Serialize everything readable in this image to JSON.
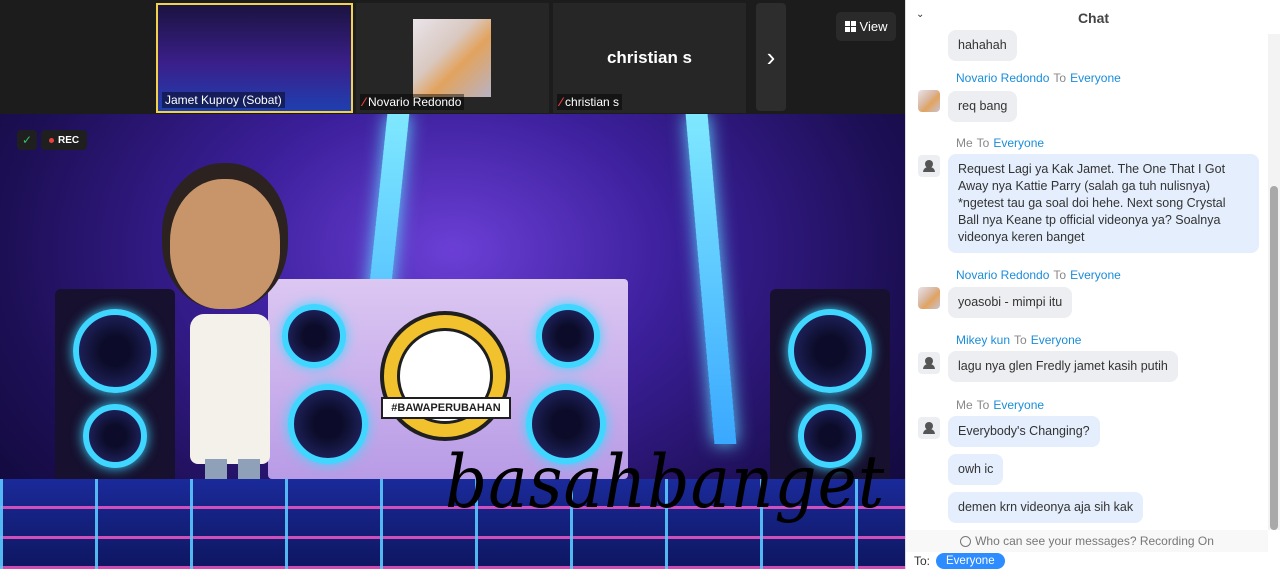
{
  "video": {
    "participants": [
      {
        "name": "Jamet Kuproy (Sobat)",
        "muted": false
      },
      {
        "name": "Novario Redondo",
        "muted": true
      },
      {
        "name": "christian s",
        "muted": true
      }
    ],
    "tile3_big_name": "christian s",
    "view_label": "View",
    "rec_label": "REC",
    "booth_ribbon": "#BAWAPERUBAHAN",
    "watermark": "basahbanget"
  },
  "chat": {
    "title": "Chat",
    "to_word": "To",
    "messages": [
      {
        "sender": "",
        "to": "",
        "text": "hahahah"
      },
      {
        "sender": "Novario Redondo",
        "to": "Everyone",
        "text": "req bang"
      },
      {
        "sender": "Me",
        "to": "Everyone",
        "text": "Request Lagi ya Kak Jamet. The One That I Got Away nya Kattie Parry (salah ga tuh nulisnya) *ngetest tau ga soal doi hehe. Next song Crystal Ball nya Keane tp official videonya ya? Soalnya videonya keren banget"
      },
      {
        "sender": "Novario Redondo",
        "to": "Everyone",
        "text": "yoasobi - mimpi itu"
      },
      {
        "sender": "Mikey kun",
        "to": "Everyone",
        "text": "lagu nya glen Fredly jamet kasih putih"
      },
      {
        "sender": "Me",
        "to": "Everyone",
        "text": "Everybody's Changing?"
      },
      {
        "sender": "",
        "to": "",
        "text": "owh ic"
      },
      {
        "sender": "",
        "to": "",
        "text": "demen krn videonya aja sih kak"
      }
    ],
    "notice": "Who can see your messages? Recording On",
    "to_label": "To:",
    "recipient": "Everyone"
  }
}
